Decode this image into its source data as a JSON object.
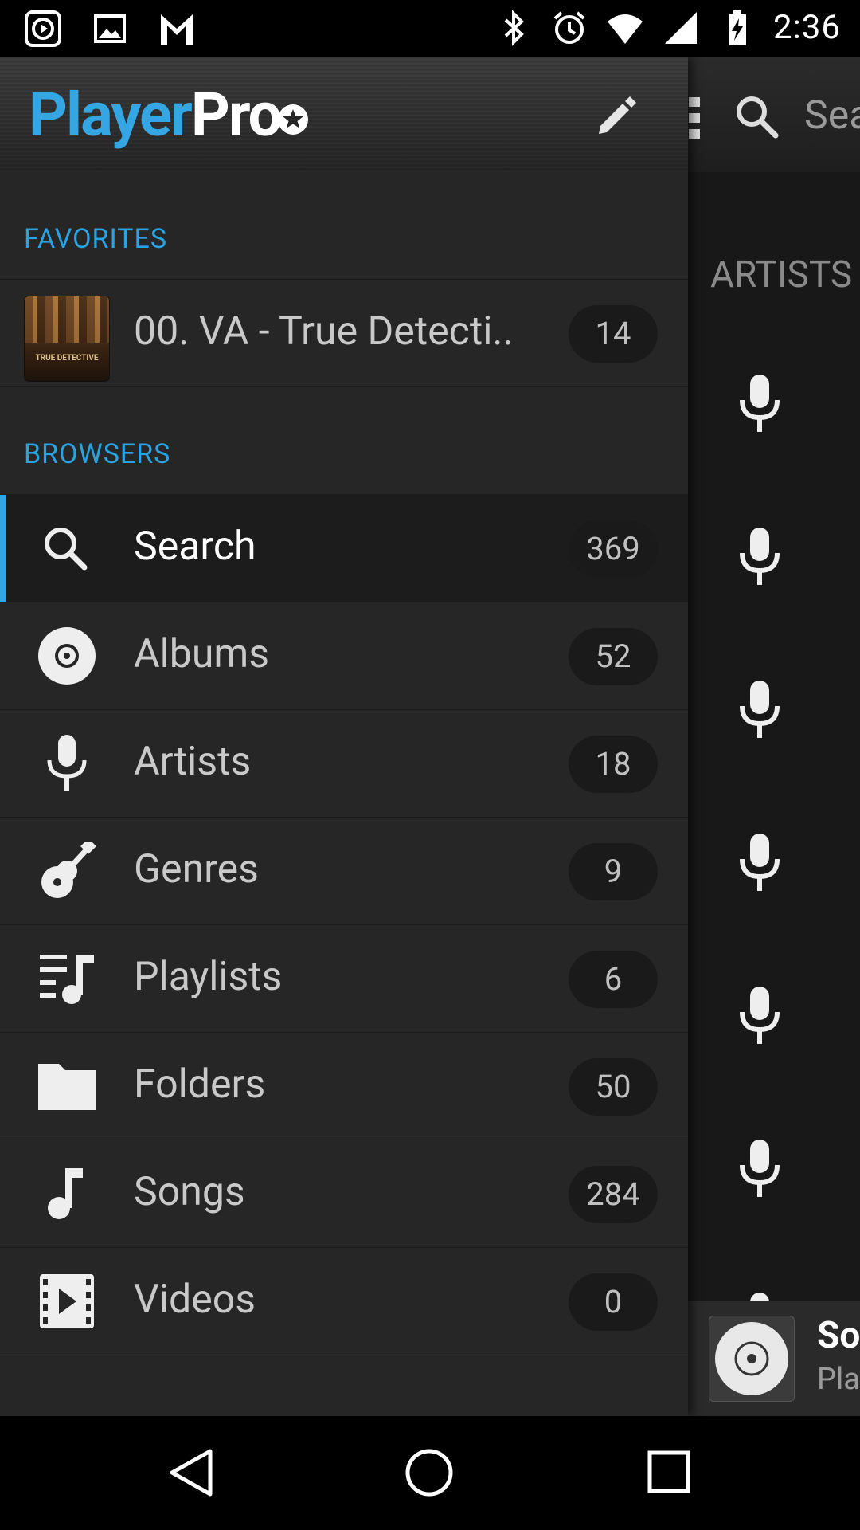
{
  "status_bar": {
    "time": "2:36",
    "left_icons": [
      "music-app-icon",
      "image-icon",
      "gmail-icon"
    ],
    "right_icons": [
      "bluetooth-icon",
      "alarm-icon",
      "wifi-icon",
      "signal-icon",
      "battery-charging-icon"
    ]
  },
  "app": {
    "logo_part1": "Player",
    "logo_part2": "Pro",
    "actions": [
      "edit-icon",
      "overflow-menu-icon"
    ],
    "accent_color": "#33a6e3"
  },
  "favorites": {
    "section_label": "FAVORITES",
    "items": [
      {
        "label": "00. VA - True Detecti..",
        "count": "14",
        "art_caption": "TRUE DETECTIVE"
      }
    ]
  },
  "browsers": {
    "section_label": "BROWSERS",
    "items": [
      {
        "label": "Search",
        "count": "369",
        "icon": "search-icon",
        "selected": true
      },
      {
        "label": "Albums",
        "count": "52",
        "icon": "album-icon"
      },
      {
        "label": "Artists",
        "count": "18",
        "icon": "microphone-icon"
      },
      {
        "label": "Genres",
        "count": "9",
        "icon": "guitar-icon"
      },
      {
        "label": "Playlists",
        "count": "6",
        "icon": "playlist-icon"
      },
      {
        "label": "Folders",
        "count": "50",
        "icon": "folder-icon"
      },
      {
        "label": "Songs",
        "count": "284",
        "icon": "music-note-icon"
      },
      {
        "label": "Videos",
        "count": "0",
        "icon": "video-icon"
      }
    ]
  },
  "background_screen": {
    "search_placeholder": "Sea",
    "section_label": "ARTISTS",
    "mini_player": {
      "title": "So",
      "subtitle": "Pla"
    }
  },
  "nav_bar": {
    "buttons": [
      "back-icon",
      "home-icon",
      "recents-icon"
    ]
  }
}
